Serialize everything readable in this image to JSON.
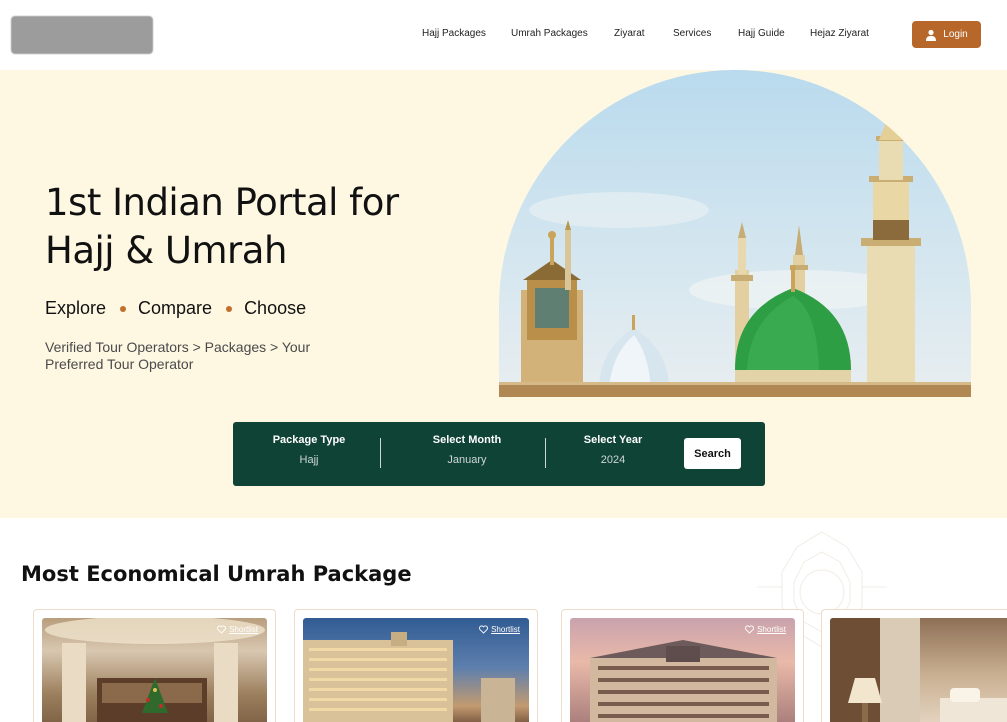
{
  "header": {
    "nav": [
      {
        "label": "Hajj Packages"
      },
      {
        "label": "Umrah Packages"
      },
      {
        "label": "Ziyarat"
      },
      {
        "label": "Services"
      },
      {
        "label": "Hajj Guide"
      },
      {
        "label": "Hejaz Ziyarat"
      }
    ],
    "login_label": "Login"
  },
  "hero": {
    "title_line1": "1st Indian Portal for",
    "title_line2": "Hajj & Umrah",
    "tagline": [
      "Explore",
      "Compare",
      "Choose"
    ],
    "subline": "Verified Tour Operators > Packages > Your Preferred Tour Operator"
  },
  "search": {
    "package_type_label": "Package Type",
    "package_type_value": "Hajj",
    "month_label": "Select Month",
    "month_value": "January",
    "year_label": "Select Year",
    "year_value": "2024",
    "search_label": "Search"
  },
  "packages": {
    "title_prefix": "Most",
    "title_bold": "Economical Umrah",
    "title_suffix": "Package",
    "cards": [
      {
        "shortlist": "Shortlist"
      },
      {
        "shortlist": "Shortlist"
      },
      {
        "shortlist": "Shortlist"
      },
      {
        "shortlist": ""
      }
    ]
  },
  "colors": {
    "hero_bg": "#fef8e3",
    "accent": "#b8672a",
    "search_bg": "#0f4336",
    "dome_green": "#2e9e45"
  }
}
